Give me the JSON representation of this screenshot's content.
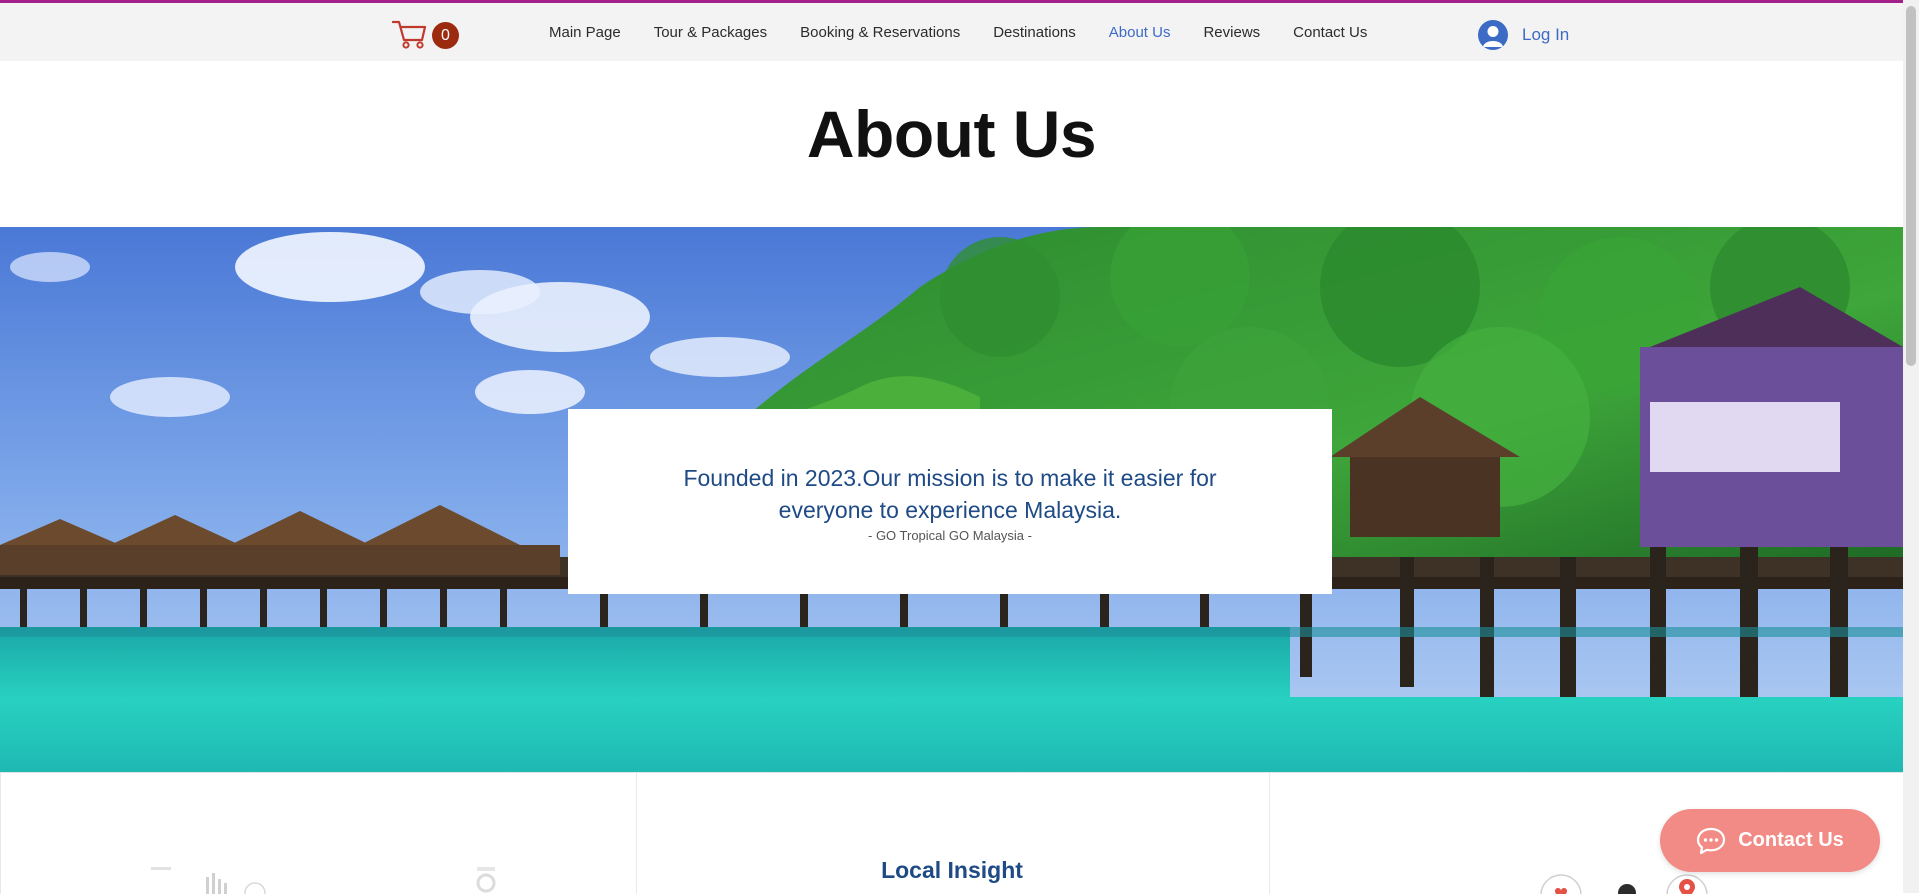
{
  "header": {
    "cart_count": "0",
    "nav": [
      {
        "label": "Main Page"
      },
      {
        "label": "Tour & Packages"
      },
      {
        "label": "Booking & Reservations"
      },
      {
        "label": "Destinations"
      },
      {
        "label": "About Us"
      },
      {
        "label": "Reviews"
      },
      {
        "label": "Contact Us"
      }
    ],
    "active_nav": "About Us",
    "login_label": "Log In"
  },
  "page": {
    "title": "About Us"
  },
  "hero": {
    "mission_line1": "Founded in 2023.Our mission is to make it easier for",
    "mission_line2": "everyone to experience Malaysia.",
    "tagline": "- GO Tropical GO Malaysia -"
  },
  "features": {
    "col2_title": "Local Insight"
  },
  "contact_float": {
    "label": "Contact Us"
  },
  "colors": {
    "accent_line": "#a3208a",
    "nav_active": "#3d6bc6",
    "mission_text": "#1e4a86",
    "contact_button": "#f28b85",
    "cart_badge": "#9b2a0e"
  },
  "icons": {
    "cart": "cart-icon",
    "avatar": "user-avatar-icon",
    "chat": "chat-bubble-icon",
    "heart": "heart-icon",
    "pin": "map-pin-icon"
  }
}
